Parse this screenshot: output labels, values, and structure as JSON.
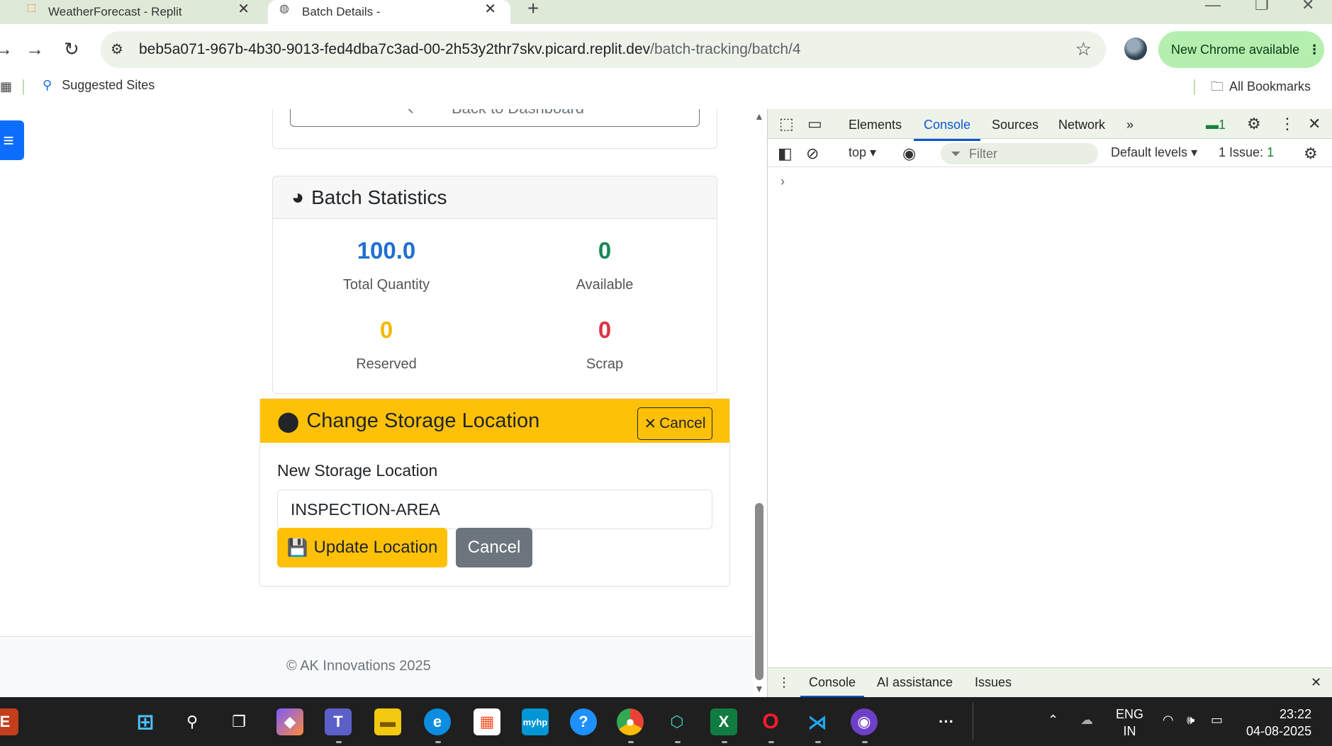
{
  "browser": {
    "tabs": [
      {
        "title": "WeatherForecast - Replit",
        "active": false
      },
      {
        "title": "Batch Details -",
        "active": true
      }
    ],
    "url_host": "beb5a071-967b-4b30-9013-fed4dba7c3ad-00-2h53y2thr7skv.picard.replit.dev",
    "url_path": "/batch-tracking/batch/4",
    "update_chip": "New Chrome available",
    "bookmark_suggested": "Suggested Sites",
    "bookmark_all": "All Bookmarks"
  },
  "page": {
    "back_button": "Back to Dashboard",
    "stats_title": "Batch Statistics",
    "stats": [
      {
        "value": "100.0",
        "label": "Total Quantity",
        "color": "#1f6fd1"
      },
      {
        "value": "0",
        "label": "Available",
        "color": "#198754"
      },
      {
        "value": "0",
        "label": "Reserved",
        "color": "#f5b800"
      },
      {
        "value": "0",
        "label": "Scrap",
        "color": "#dc3545"
      }
    ],
    "location_title": "Change Storage Location",
    "header_cancel": "Cancel",
    "field_label": "New Storage Location",
    "field_value": "INSPECTION-AREA",
    "update_button": "Update Location",
    "cancel_button": "Cancel",
    "footer": "© AK Innovations 2025"
  },
  "devtools": {
    "tabs": [
      "Elements",
      "Console",
      "Sources",
      "Network"
    ],
    "active_tab": "Console",
    "messages_badge": "1",
    "context": "top",
    "filter_placeholder": "Filter",
    "levels": "Default levels",
    "issues": "1 Issue:",
    "issues_count": "1",
    "drawer_tabs": [
      "Console",
      "AI assistance",
      "Issues"
    ]
  },
  "taskbar": {
    "lang": "ENG",
    "region": "IN",
    "time": "23:22",
    "date": "04-08-2025"
  }
}
